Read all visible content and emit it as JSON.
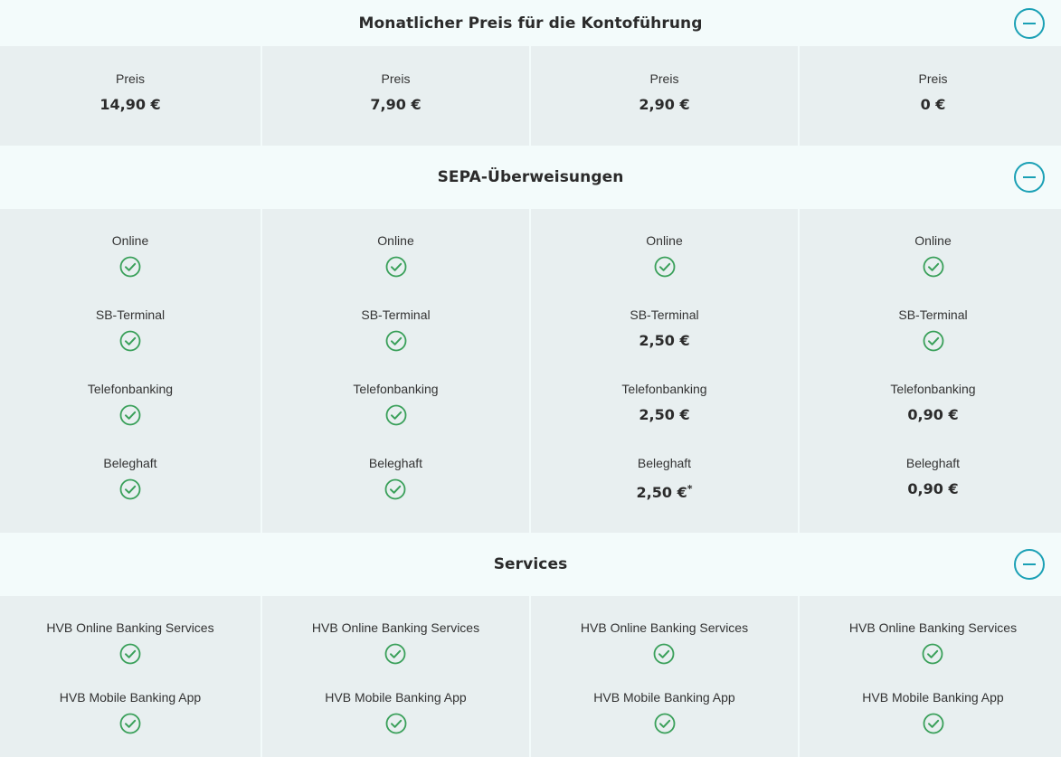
{
  "sections": [
    {
      "title": "Monatlicher Preis für die Kontoführung",
      "columns": [
        {
          "rows": [
            {
              "label": "Preis",
              "value": "14,90 €"
            }
          ]
        },
        {
          "rows": [
            {
              "label": "Preis",
              "value": "7,90 €"
            }
          ]
        },
        {
          "rows": [
            {
              "label": "Preis",
              "value": "2,90 €"
            }
          ]
        },
        {
          "rows": [
            {
              "label": "Preis",
              "value": "0 €"
            }
          ]
        }
      ]
    },
    {
      "title": "SEPA-Überweisungen",
      "columns": [
        {
          "rows": [
            {
              "label": "Online",
              "check": true
            },
            {
              "label": "SB-Terminal",
              "check": true
            },
            {
              "label": "Telefonbanking",
              "check": true
            },
            {
              "label": "Beleghaft",
              "check": true
            }
          ]
        },
        {
          "rows": [
            {
              "label": "Online",
              "check": true
            },
            {
              "label": "SB-Terminal",
              "check": true
            },
            {
              "label": "Telefonbanking",
              "check": true
            },
            {
              "label": "Beleghaft",
              "check": true
            }
          ]
        },
        {
          "rows": [
            {
              "label": "Online",
              "check": true
            },
            {
              "label": "SB-Terminal",
              "value": "2,50 €"
            },
            {
              "label": "Telefonbanking",
              "value": "2,50 €"
            },
            {
              "label": "Beleghaft",
              "value": "2,50 €",
              "footnote": "*"
            }
          ]
        },
        {
          "rows": [
            {
              "label": "Online",
              "check": true
            },
            {
              "label": "SB-Terminal",
              "check": true
            },
            {
              "label": "Telefonbanking",
              "value": "0,90 €"
            },
            {
              "label": "Beleghaft",
              "value": "0,90 €"
            }
          ]
        }
      ]
    },
    {
      "title": "Services",
      "columns": [
        {
          "rows": [
            {
              "label": "HVB Online Banking Services",
              "check": true
            },
            {
              "label": "HVB Mobile Banking App",
              "check": true
            }
          ]
        },
        {
          "rows": [
            {
              "label": "HVB Online Banking Services",
              "check": true
            },
            {
              "label": "HVB Mobile Banking App",
              "check": true
            }
          ]
        },
        {
          "rows": [
            {
              "label": "HVB Online Banking Services",
              "check": true
            },
            {
              "label": "HVB Mobile Banking App",
              "check": true
            }
          ]
        },
        {
          "rows": [
            {
              "label": "HVB Online Banking Services",
              "check": true
            },
            {
              "label": "HVB Mobile Banking App",
              "check": true
            }
          ]
        }
      ]
    }
  ],
  "icons": {
    "collapse": "minus-circle-icon",
    "included": "check-circle-icon"
  },
  "colors": {
    "accent": "#1aa0b5",
    "check": "#3aa05a",
    "header_bg": "#f3fbfb",
    "cell_bg": "#e8eff0"
  }
}
